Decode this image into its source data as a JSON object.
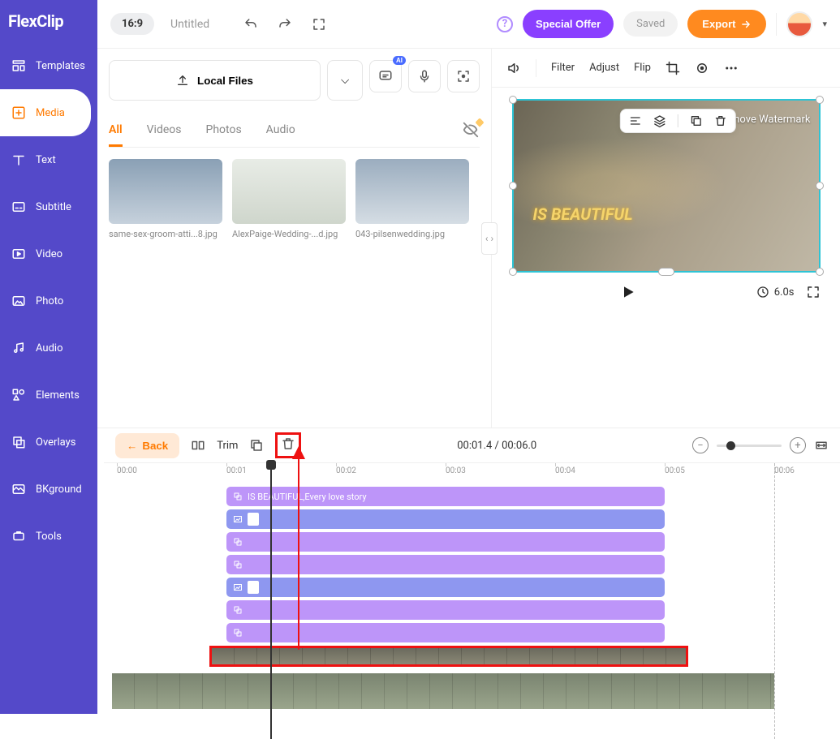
{
  "app": {
    "name": "FlexClip"
  },
  "topbar": {
    "ratio": "16:9",
    "title": "Untitled",
    "offer": "Special Offer",
    "saved": "Saved",
    "export": "Export"
  },
  "sidebar": {
    "items": [
      {
        "label": "Templates"
      },
      {
        "label": "Media"
      },
      {
        "label": "Text"
      },
      {
        "label": "Subtitle"
      },
      {
        "label": "Video"
      },
      {
        "label": "Photo"
      },
      {
        "label": "Audio"
      },
      {
        "label": "Elements"
      },
      {
        "label": "Overlays"
      },
      {
        "label": "BKground"
      },
      {
        "label": "Tools"
      }
    ]
  },
  "media": {
    "upload_label": "Local Files",
    "tabs": [
      "All",
      "Videos",
      "Photos",
      "Audio"
    ],
    "thumbs": [
      {
        "caption": "same-sex-groom-atti...8.jpg"
      },
      {
        "caption": "AlexPaige-Wedding-...d.jpg"
      },
      {
        "caption": "043-pilsenwedding.jpg"
      }
    ]
  },
  "preview": {
    "toolbar": [
      "Filter",
      "Adjust",
      "Flip"
    ],
    "watermark": "Remove Watermark",
    "text_overlay": "IS BEAUTIFUL",
    "duration": "6.0s"
  },
  "timeline": {
    "back": "Back",
    "trim": "Trim",
    "time": "00:01.4 / 00:06.0",
    "ruler": [
      "00:00",
      "00:01",
      "00:02",
      "00:03",
      "00:04",
      "00:05",
      "00:06"
    ],
    "tracks": {
      "text_clip": "IS BEAUTIFUL,Every love story"
    }
  }
}
